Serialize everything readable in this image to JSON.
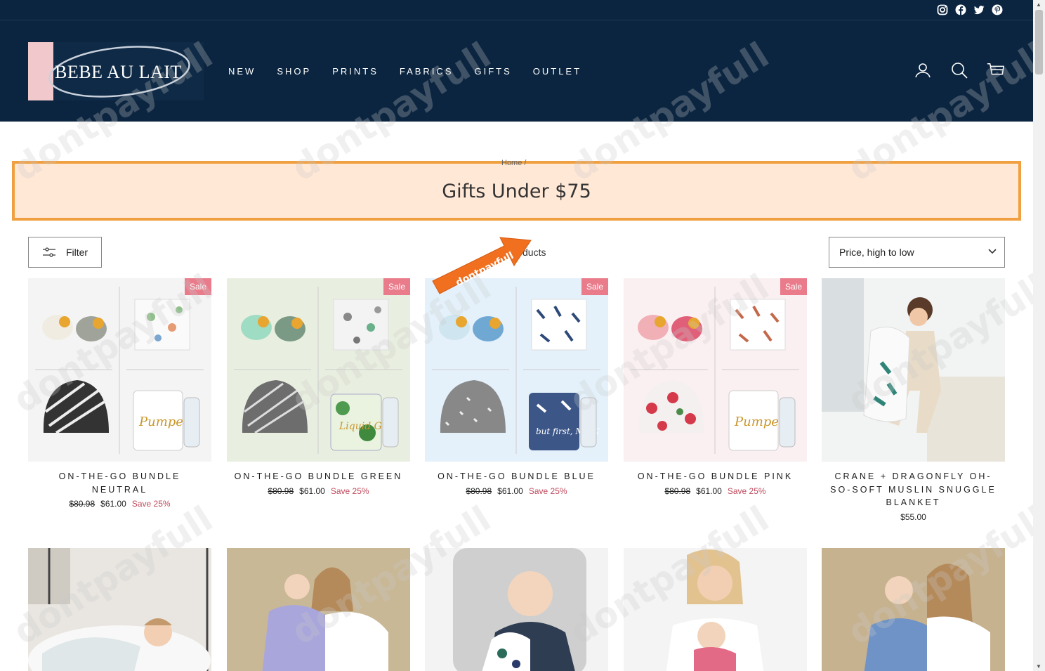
{
  "social": [
    "instagram-icon",
    "facebook-icon",
    "twitter-icon",
    "pinterest-icon"
  ],
  "logo": {
    "text": "BEBE AU LAIT"
  },
  "nav": [
    "NEW",
    "SHOP",
    "PRINTS",
    "FABRICS",
    "GIFTS",
    "OUTLET"
  ],
  "header_icons": [
    "account-icon",
    "search-icon",
    "cart-icon"
  ],
  "breadcrumb": "Home /",
  "page_title": "Gifts Under $75",
  "filter_label": "Filter",
  "product_count": "ducts",
  "sort": {
    "selected": "Price, high to low"
  },
  "promo_arrow_text": "dontpayfull",
  "sale_badge": "Sale",
  "products": [
    {
      "title": "ON-THE-GO BUNDLE NEUTRAL",
      "was": "$80.98",
      "price": "$61.00",
      "save": "Save 25%"
    },
    {
      "title": "ON-THE-GO BUNDLE GREEN",
      "was": "$80.98",
      "price": "$61.00",
      "save": "Save 25%"
    },
    {
      "title": "ON-THE-GO BUNDLE BLUE",
      "was": "$80.98",
      "price": "$61.00",
      "save": "Save 25%"
    },
    {
      "title": "ON-THE-GO BUNDLE PINK",
      "was": "$80.98",
      "price": "$61.00",
      "save": "Save 25%"
    },
    {
      "title": "CRANE + DRAGONFLY OH-SO-SOFT MUSLIN SNUGGLE BLANKET",
      "price": "$55.00"
    }
  ],
  "watermark": "dontpayfull",
  "colors": {
    "navy": "#0b2540",
    "sale": "#e97b8b",
    "banner_bg": "#ffe8d6",
    "banner_border": "#f0a040",
    "promo_orange": "#f07020"
  }
}
